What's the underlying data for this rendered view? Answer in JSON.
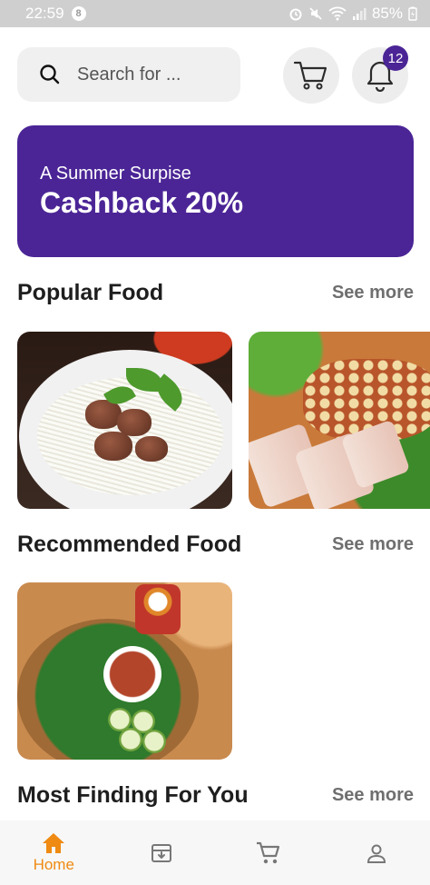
{
  "status_bar": {
    "time": "22:59",
    "notification_count": "8",
    "battery": "85%"
  },
  "search": {
    "placeholder": "Search for ..."
  },
  "notifications": {
    "badge_count": "12"
  },
  "banner": {
    "subtitle": "A Summer Surpise",
    "title": "Cashback 20%"
  },
  "sections": {
    "popular": {
      "title": "Popular Food",
      "see_more": "See more"
    },
    "recommended": {
      "title": "Recommended Food",
      "see_more": "See more"
    },
    "most_finding": {
      "title": "Most Finding For You",
      "see_more": "See more"
    }
  },
  "bottom_nav": {
    "items": [
      {
        "icon": "home-icon",
        "label": "Home",
        "active": true
      },
      {
        "icon": "archive-icon",
        "label": ""
      },
      {
        "icon": "cart-icon",
        "label": ""
      },
      {
        "icon": "profile-icon",
        "label": ""
      }
    ]
  },
  "colors": {
    "brand": "#4b2596",
    "active_nav": "#ef8a12",
    "see_more": "#6f6f6f"
  }
}
